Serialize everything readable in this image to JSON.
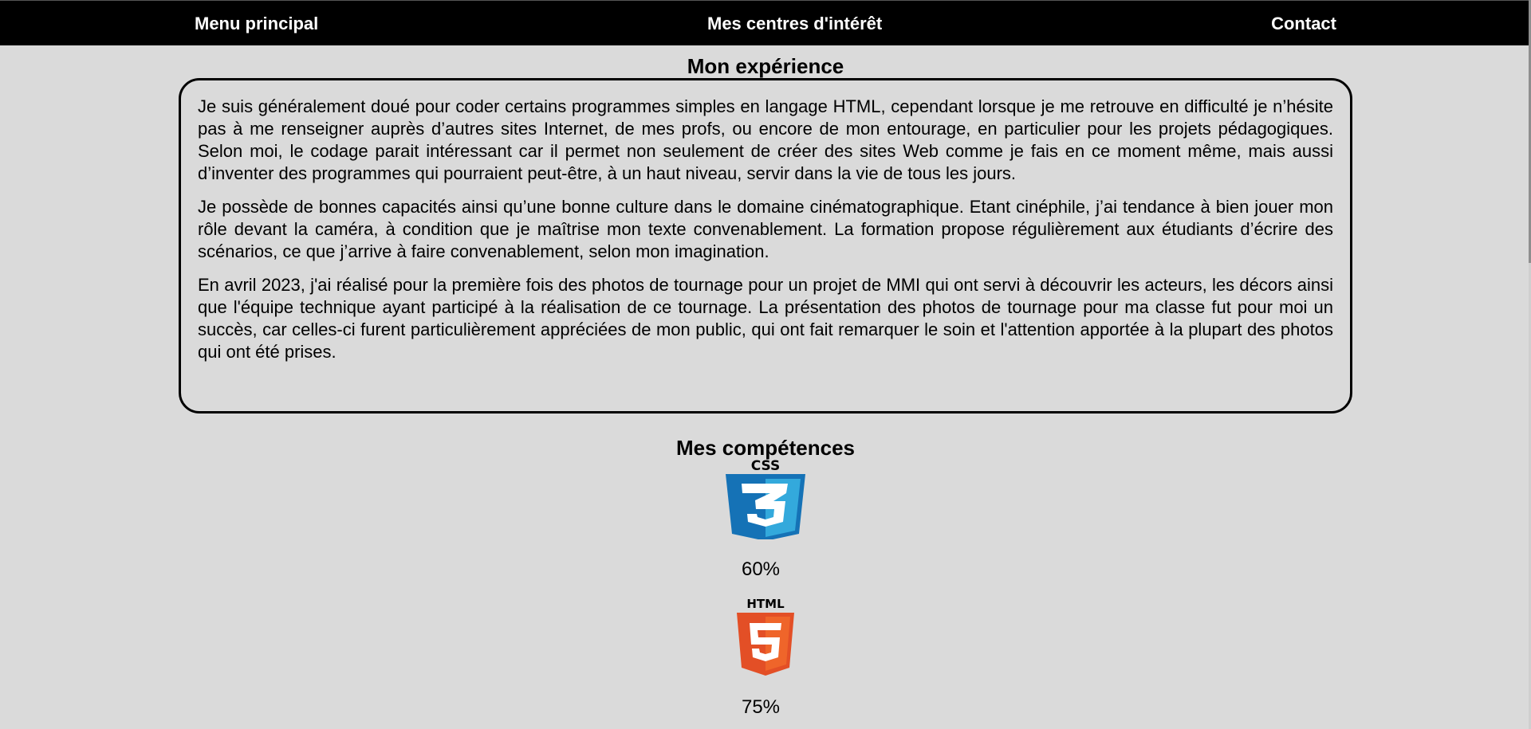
{
  "nav": {
    "left": "Menu principal",
    "center": "Mes centres d'intérêt",
    "right": "Contact"
  },
  "experience": {
    "title": "Mon expérience",
    "paragraphs": [
      "Je suis généralement doué pour coder certains programmes simples en langage HTML, cependant lorsque je me retrouve en difficulté je n’hésite pas à me renseigner auprès d’autres sites Internet, de mes profs, ou encore de mon entourage, en particulier pour les projets pédagogiques. Selon moi, le codage parait intéressant car il permet non seulement de créer des sites Web comme je fais en ce moment même, mais aussi d’inventer des programmes qui pourraient peut-être, à un haut niveau, servir dans la vie de tous les jours.",
      "Je possède de bonnes capacités ainsi qu’une bonne culture dans le domaine cinématographique. Etant cinéphile, j’ai tendance à bien jouer mon rôle devant la caméra, à condition que je maîtrise mon texte convenablement. La formation propose régulièrement aux étudiants d’écrire des scénarios, ce que j’arrive à faire convenablement, selon mon imagination.",
      "En avril 2023, j'ai réalisé pour la première fois des photos de tournage pour un projet de MMI qui ont servi à découvrir les acteurs, les décors ainsi que l'équipe technique ayant participé à la réalisation de ce tournage. La présentation des photos de tournage pour ma classe fut pour moi un succès, car celles-ci furent particulièrement appréciées de mon public, qui ont fait remarquer le soin et l'attention apportée à la plupart des photos qui ont été prises."
    ]
  },
  "skills": {
    "title": "Mes compétences",
    "items": [
      {
        "icon": "css3-logo-icon",
        "logo_text": "CSS",
        "percent": "60%"
      },
      {
        "icon": "html5-logo-icon",
        "logo_text": "HTML",
        "percent": "75%"
      }
    ]
  },
  "colors": {
    "background": "#dadada",
    "nav_background": "#000000",
    "css_blue": "#1572b6",
    "css_light_blue": "#33a9dc",
    "html_orange": "#e34f26",
    "html_light_orange": "#ef652a"
  }
}
